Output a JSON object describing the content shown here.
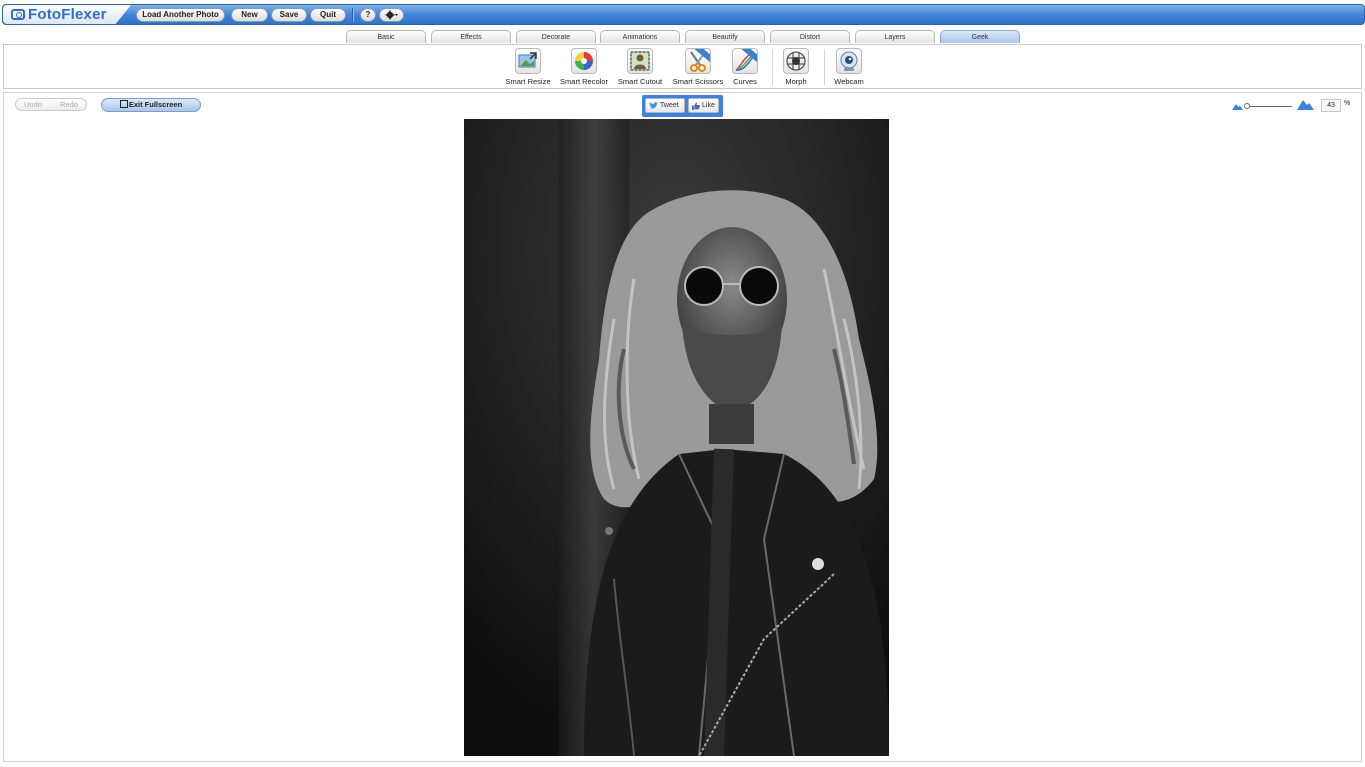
{
  "app": {
    "logo_text": "FotoFlexer",
    "brand_color": "#2d6fc8",
    "bar_color": "#3f82d6"
  },
  "toolbar": {
    "load_label": "Load Another Photo",
    "new_label": "New",
    "save_label": "Save",
    "quit_label": "Quit",
    "help_label": "?",
    "settings_icon": "gear-icon"
  },
  "tabs": [
    {
      "label": "Basic"
    },
    {
      "label": "Effects"
    },
    {
      "label": "Decorate"
    },
    {
      "label": "Animations"
    },
    {
      "label": "Beautify"
    },
    {
      "label": "Distort"
    },
    {
      "label": "Layers"
    },
    {
      "label": "Geek",
      "active": true
    }
  ],
  "tools": [
    {
      "label": "Smart Resize",
      "icon": "smart-resize-icon"
    },
    {
      "label": "Smart Recolor",
      "icon": "color-wheel-icon"
    },
    {
      "label": "Smart Cutout",
      "icon": "cutout-icon"
    },
    {
      "label": "Smart Scissors",
      "icon": "scissors-icon"
    },
    {
      "label": "Curves",
      "icon": "curves-icon"
    },
    {
      "label": "Morph",
      "icon": "morph-icon"
    },
    {
      "label": "Webcam",
      "icon": "webcam-icon"
    }
  ],
  "history": {
    "undo_label": "Undo",
    "redo_label": "Redo"
  },
  "fullscreen": {
    "exit_label": "Exit Fullscreen"
  },
  "social": {
    "tweet_label": "Tweet",
    "like_label": "Like"
  },
  "zoom": {
    "value": "43",
    "unit": "%"
  },
  "photo": {
    "subject": "black-and-white portrait of long-haired bearded man in sunglasses and leather jacket"
  }
}
